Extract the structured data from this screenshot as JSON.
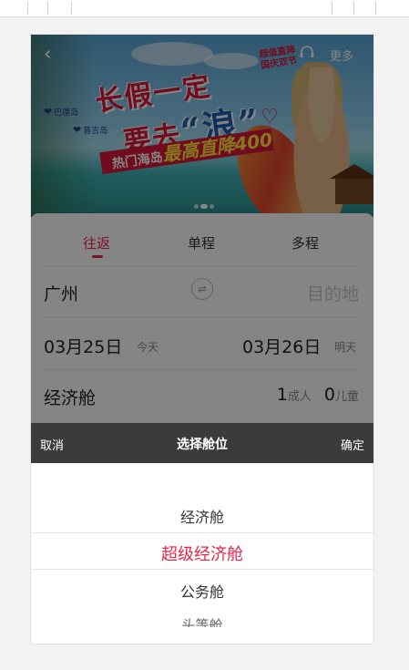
{
  "header": {
    "back_icon": "chevron-left-icon",
    "service_icon": "headset-icon",
    "more_label": "更多"
  },
  "banner": {
    "headline_line1": "长假一定",
    "headline_line2_prefix": "要去",
    "headline_line2_word": "“浪”",
    "promo_prefix": "热门海岛",
    "promo_mid": "最高直降",
    "promo_value": "400",
    "stamp_line1": "超值直降",
    "stamp_line2": "国庆双节",
    "island_1": "巴厘岛",
    "island_2": "普吉岛",
    "slide_count": 3,
    "active_slide": 1
  },
  "trip_tabs": [
    {
      "label": "往返",
      "active": true
    },
    {
      "label": "单程",
      "active": false
    },
    {
      "label": "多程",
      "active": false
    }
  ],
  "route": {
    "from": "广州",
    "to_placeholder": "目的地",
    "swap_icon": "swap-icon"
  },
  "dates": {
    "depart": "03月25日",
    "depart_note": "今天",
    "return": "03月26日",
    "return_note": "明天"
  },
  "cabin": {
    "label": "经济舱",
    "adults": "1",
    "adults_unit": "成人",
    "children": "0",
    "children_unit": "儿童"
  },
  "picker": {
    "cancel": "取消",
    "title": "选择舱位",
    "confirm": "确定",
    "options": [
      "经济舱",
      "超级经济舱",
      "公务舱",
      "头等舱"
    ],
    "selected_index": 1
  },
  "colors": {
    "accent": "#e8254b",
    "picker_header": "#3b3b3b"
  }
}
